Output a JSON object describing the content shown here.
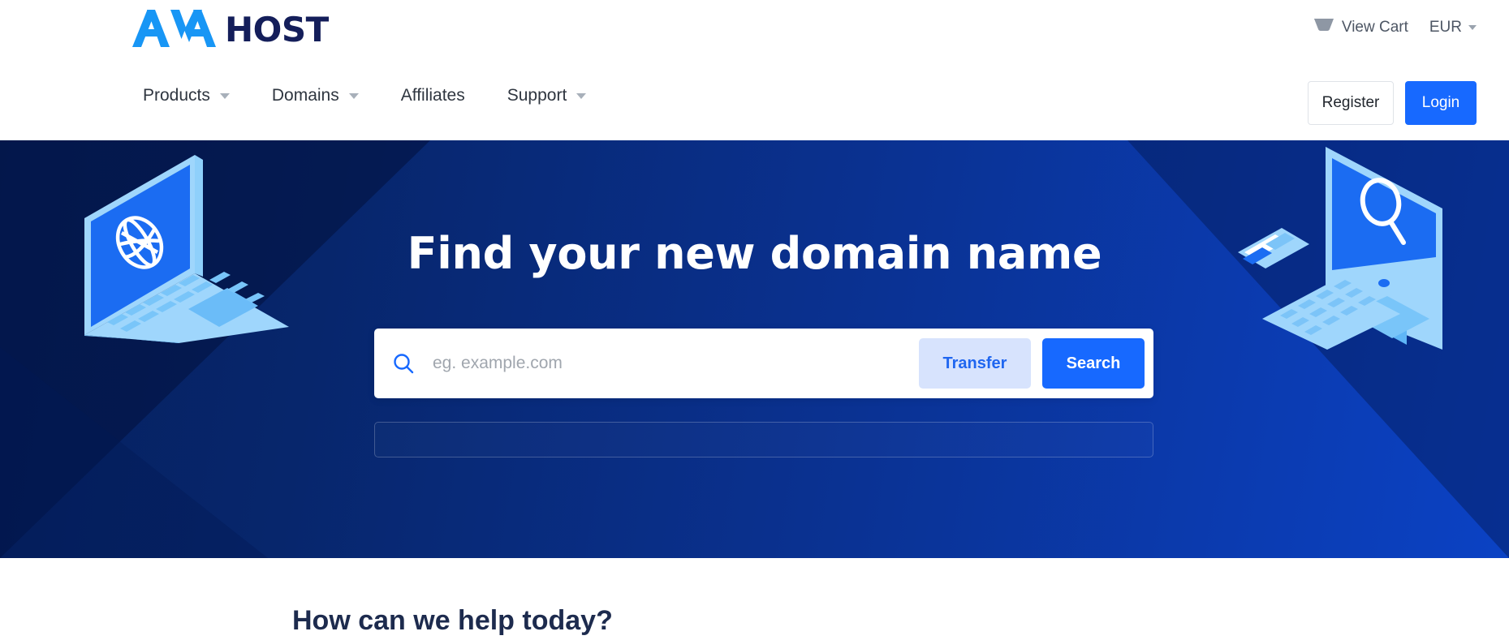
{
  "brand": {
    "logo_mark_text": "AVA",
    "logo_word": "HOST",
    "logo_mark_color": "#1896f5",
    "logo_word_color": "#141e5a",
    "accent_blue": "#1769ff",
    "accent_light_blue": "#d7e3fd"
  },
  "topbar": {
    "cart_icon": "shopping-basket-icon",
    "cart_label": "View Cart",
    "currency_label": "EUR",
    "currency_caret_icon": "chevron-down-icon"
  },
  "nav": {
    "items": [
      {
        "label": "Products",
        "has_dropdown": true
      },
      {
        "label": "Domains",
        "has_dropdown": true
      },
      {
        "label": "Affiliates",
        "has_dropdown": false
      },
      {
        "label": "Support",
        "has_dropdown": true
      }
    ],
    "register_label": "Register",
    "login_label": "Login"
  },
  "hero": {
    "title": "Find your new domain name",
    "background_from": "#06205e",
    "background_to": "#0b42c4",
    "search": {
      "icon": "search-icon",
      "value": "",
      "placeholder": "eg. example.com",
      "transfer_label": "Transfer",
      "search_label": "Search"
    },
    "illustration_left": "isometric-laptop-with-globe",
    "illustration_right": "isometric-desktop-with-magnifier"
  },
  "below_hero": {
    "section_title": "How can we help today?"
  }
}
